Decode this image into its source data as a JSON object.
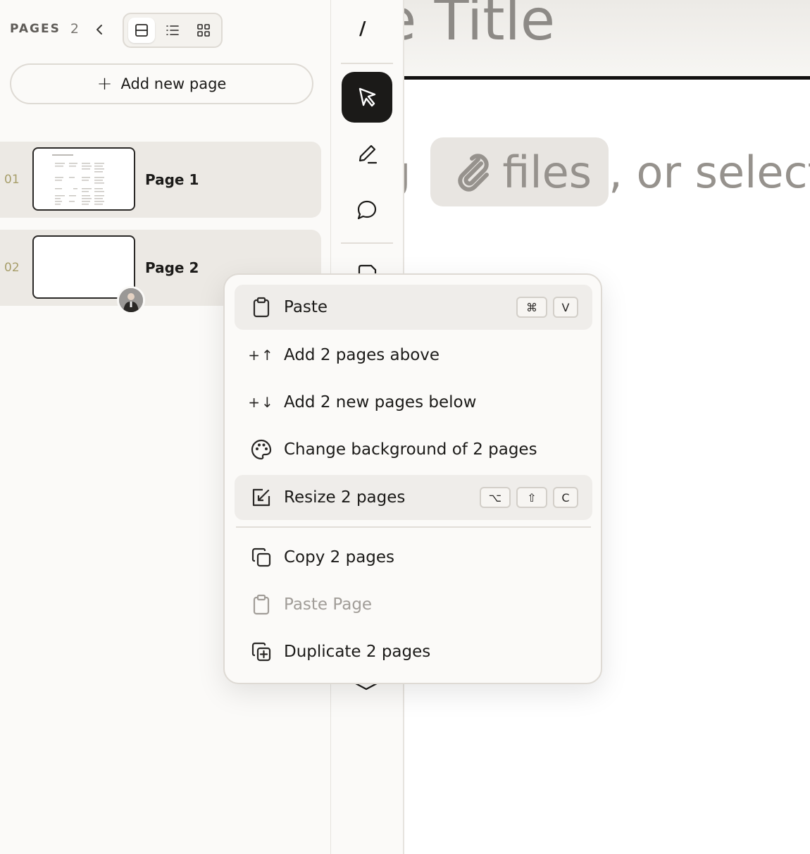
{
  "sidebar": {
    "pages_label": "PAGES",
    "pages_count": "2",
    "add_page_label": "Add new page",
    "pages": [
      {
        "number": "01",
        "name": "Page 1"
      },
      {
        "number": "02",
        "name": "Page 2"
      }
    ]
  },
  "toolbar": {
    "slash_label": "/"
  },
  "canvas": {
    "title_text": "e Title",
    "drop_prefix": "g",
    "files_label": "files",
    "drop_suffix": ", or select"
  },
  "menu": {
    "items": [
      {
        "label": "Paste",
        "icon": "clipboard-icon",
        "keys": [
          "⌘",
          "V"
        ]
      },
      {
        "label": "Add 2 pages above",
        "icon": "plus-up-icon"
      },
      {
        "label": "Add 2 new pages below",
        "icon": "plus-down-icon"
      },
      {
        "label": "Change background of 2 pages",
        "icon": "palette-icon"
      },
      {
        "label": "Resize 2 pages",
        "icon": "resize-icon",
        "keys": [
          "⌥",
          "⇧",
          "C"
        ]
      },
      {
        "label": "Copy 2 pages",
        "icon": "copy-icon"
      },
      {
        "label": "Paste Page",
        "icon": "clipboard-icon"
      },
      {
        "label": "Duplicate 2 pages",
        "icon": "duplicate-icon"
      }
    ]
  },
  "colors": {
    "background": "#fbfaf8",
    "highlight": "#efedea",
    "text": "#1b1a18",
    "muted": "#a19d98",
    "page_number": "#a79e6a",
    "active_tool": "#1b1a18"
  }
}
